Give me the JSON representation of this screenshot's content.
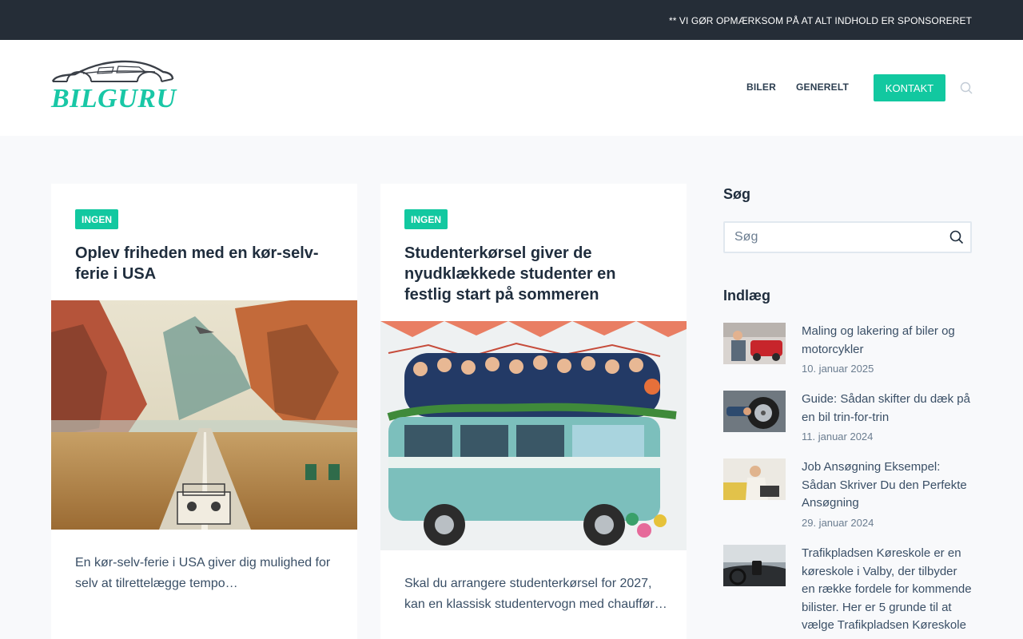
{
  "topbar": {
    "notice": "** VI GØR OPMÆRKSOM PÅ AT ALT INDHOLD ER SPONSORERET"
  },
  "header": {
    "logo_text": "BILGURU",
    "logo_icon": "car-outline-icon",
    "nav": {
      "biler": "BILER",
      "generelt": "GENERELT",
      "kontakt": "KONTAKT"
    },
    "search_icon": "search-icon"
  },
  "colors": {
    "accent": "#12c8a0",
    "topbar": "#252d37",
    "heading": "#1f2d3d",
    "text": "#3a4f66"
  },
  "cards": [
    {
      "category": "INGEN",
      "title": "Oplev friheden med en kør-selv-ferie i USA",
      "excerpt": "En kør-selv-ferie i USA giver dig mulighed for selv at tilrettelægge tempo…"
    },
    {
      "category": "INGEN",
      "title": "Studenterkørsel giver de nyudklækkede studenter en festlig start på sommeren",
      "excerpt": "Skal du arrangere studenterkørsel for 2027, kan en klassisk studentervogn med chauffør…"
    }
  ],
  "sidebar": {
    "search_heading": "Søg",
    "search_placeholder": "Søg",
    "posts_heading": "Indlæg",
    "posts": [
      {
        "title": "Maling og lakering af biler og motorcykler",
        "date": "10. januar 2025"
      },
      {
        "title": "Guide: Sådan skifter du dæk på en bil trin-for-trin",
        "date": "11. januar 2024"
      },
      {
        "title": "Job Ansøgning Eksempel: Sådan Skriver Du den Perfekte Ansøgning",
        "date": "29. januar 2024"
      },
      {
        "title": "Trafikpladsen Køreskole er en køreskole i Valby, der tilbyder en række fordele for kommende bilister. Her er 5 grunde til at vælge Trafikpladsen Køreskole",
        "date": ""
      }
    ]
  }
}
